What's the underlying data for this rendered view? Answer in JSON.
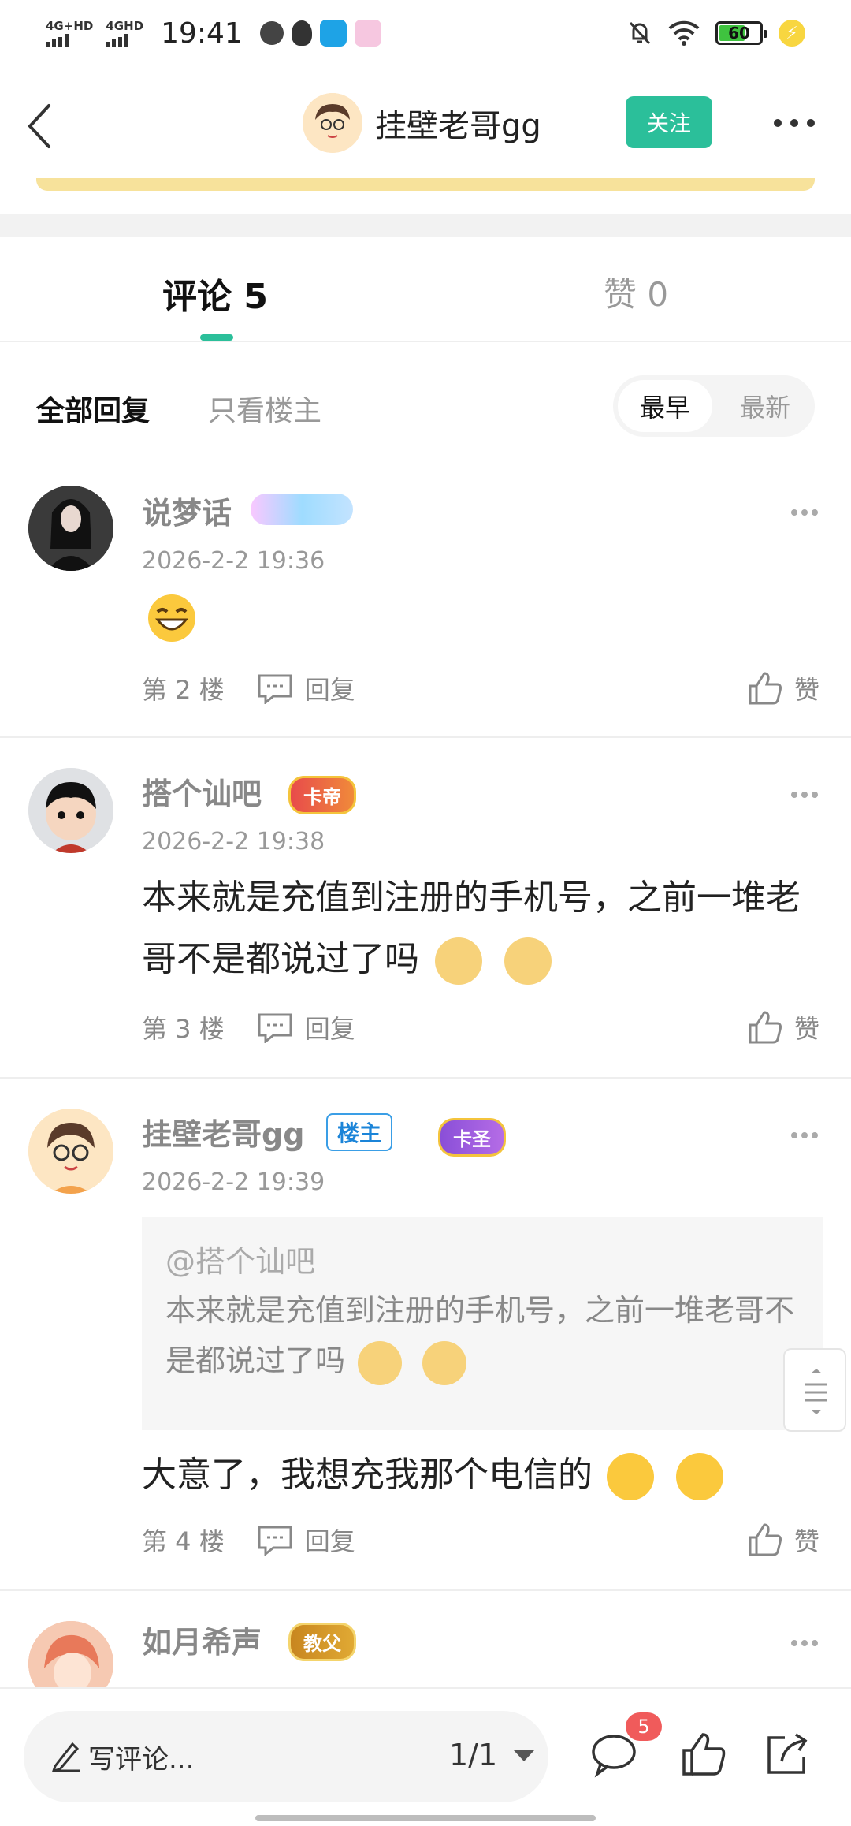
{
  "status_bar": {
    "net1": "4G+HD",
    "net2": "4GHD",
    "time": "19:41",
    "battery": "60"
  },
  "header": {
    "title": "挂壁老哥gg",
    "follow_label": "关注"
  },
  "tabs": {
    "comments_label": "评论 5",
    "likes_label": "赞 0"
  },
  "filters": {
    "all_label": "全部回复",
    "op_only_label": "只看楼主",
    "sort_early": "最早",
    "sort_new": "最新"
  },
  "comments": [
    {
      "name": "说梦话",
      "time": "2026-2-2 19:36",
      "floor": "第 2 楼",
      "reply_label": "回复",
      "like_label": "赞"
    },
    {
      "name": "搭个讪吧",
      "badge": "卡帝",
      "time": "2026-2-2 19:38",
      "text": "本来就是充值到注册的手机号，之前一堆老哥不是都说过了吗",
      "floor": "第 3 楼",
      "reply_label": "回复",
      "like_label": "赞"
    },
    {
      "name": "挂壁老哥gg",
      "op_tag": "楼主",
      "badge": "卡圣",
      "time": "2026-2-2 19:39",
      "quote_user": "@搭个讪吧",
      "quote_text": "本来就是充值到注册的手机号，之前一堆老哥不是都说过了吗",
      "text": "大意了，我想充我那个电信的",
      "floor": "第 4 楼",
      "reply_label": "回复",
      "like_label": "赞"
    },
    {
      "name": "如月希声",
      "badge": "教父"
    }
  ],
  "bottom_bar": {
    "write_placeholder": "写评论...",
    "page_indicator": "1/1",
    "comment_count": "5"
  },
  "colors": {
    "accent": "#2bbf9a",
    "badge_red": "#f05b5b"
  },
  "icons": [
    "back-icon",
    "more-icon",
    "edit-pencil-icon",
    "comment-bubble-icon",
    "thumbs-up-icon",
    "share-icon",
    "reply-bubble-icon"
  ]
}
